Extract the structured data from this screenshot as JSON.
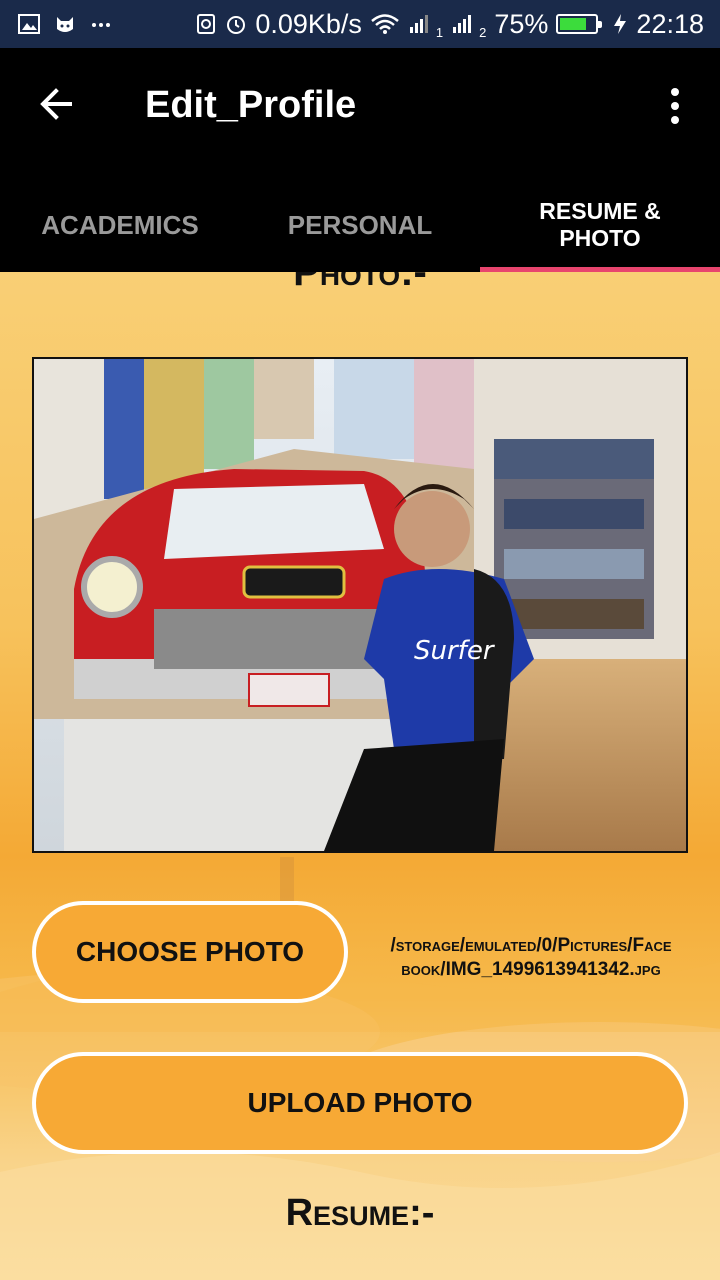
{
  "status_bar": {
    "network_speed": "0.09Kb/s",
    "sim1_label": "1",
    "sim2_label": "2",
    "battery_percent": "75%",
    "battery_level": 0.75,
    "time": "22:18",
    "icons": [
      "image-icon",
      "cat-notification-icon",
      "more-dots-icon",
      "nfc-icon",
      "alarm-icon",
      "wifi-icon",
      "signal-icon",
      "signal-icon",
      "battery-icon",
      "charging-icon"
    ]
  },
  "app_bar": {
    "title": "Edit_Profile",
    "back_icon": "arrow-left-icon",
    "overflow_icon": "more-vert-icon"
  },
  "tabs": [
    {
      "label": "ACADEMICS",
      "active": false
    },
    {
      "label": "PERSONAL",
      "active": false
    },
    {
      "label": "RESUME & PHOTO",
      "active": true
    }
  ],
  "colors": {
    "tab_indicator": "#e8456e",
    "button_fill": "#f7a935",
    "status_bar": "#1a2a4a"
  },
  "content": {
    "photo_heading": "Photo:-",
    "choose_button": "CHOOSE PHOTO",
    "file_path": "/storage/emulated/0/Pictures/Facebook/IMG_1499613941342.jpg",
    "upload_button": "UPLOAD PHOTO",
    "resume_label": "Resume:-"
  }
}
